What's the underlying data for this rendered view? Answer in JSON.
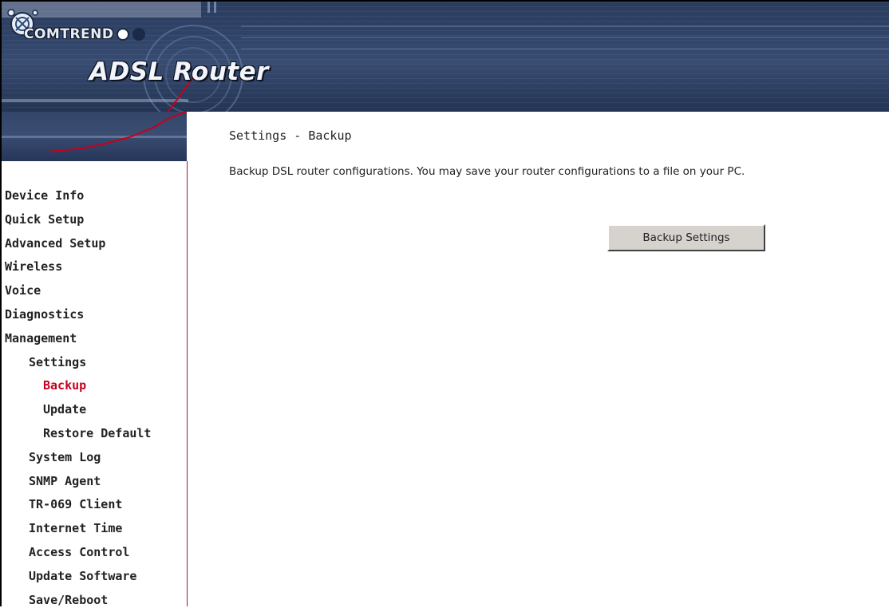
{
  "header": {
    "brand": "COMTREND",
    "product": "ADSL Router",
    "colors": {
      "banner": "#2f4368",
      "accent_red": "#c6001e",
      "nav_border": "#9e1b2d"
    }
  },
  "sidebar": {
    "items": [
      {
        "label": "Device Info",
        "level": 0,
        "active": false
      },
      {
        "label": "Quick Setup",
        "level": 0,
        "active": false
      },
      {
        "label": "Advanced Setup",
        "level": 0,
        "active": false
      },
      {
        "label": "Wireless",
        "level": 0,
        "active": false
      },
      {
        "label": "Voice",
        "level": 0,
        "active": false
      },
      {
        "label": "Diagnostics",
        "level": 0,
        "active": false
      },
      {
        "label": "Management",
        "level": 0,
        "active": false
      },
      {
        "label": "Settings",
        "level": 1,
        "active": false
      },
      {
        "label": "Backup",
        "level": 2,
        "active": true
      },
      {
        "label": "Update",
        "level": 2,
        "active": false
      },
      {
        "label": "Restore Default",
        "level": 2,
        "active": false
      },
      {
        "label": "System Log",
        "level": 1,
        "active": false
      },
      {
        "label": "SNMP Agent",
        "level": 1,
        "active": false
      },
      {
        "label": "TR-069 Client",
        "level": 1,
        "active": false
      },
      {
        "label": "Internet Time",
        "level": 1,
        "active": false
      },
      {
        "label": "Access Control",
        "level": 1,
        "active": false
      },
      {
        "label": "Update Software",
        "level": 1,
        "active": false
      },
      {
        "label": "Save/Reboot",
        "level": 1,
        "active": false
      }
    ]
  },
  "main": {
    "title": "Settings - Backup",
    "description": "Backup DSL router configurations. You may save your router configurations to a file on your PC.",
    "backup_button": "Backup Settings"
  }
}
